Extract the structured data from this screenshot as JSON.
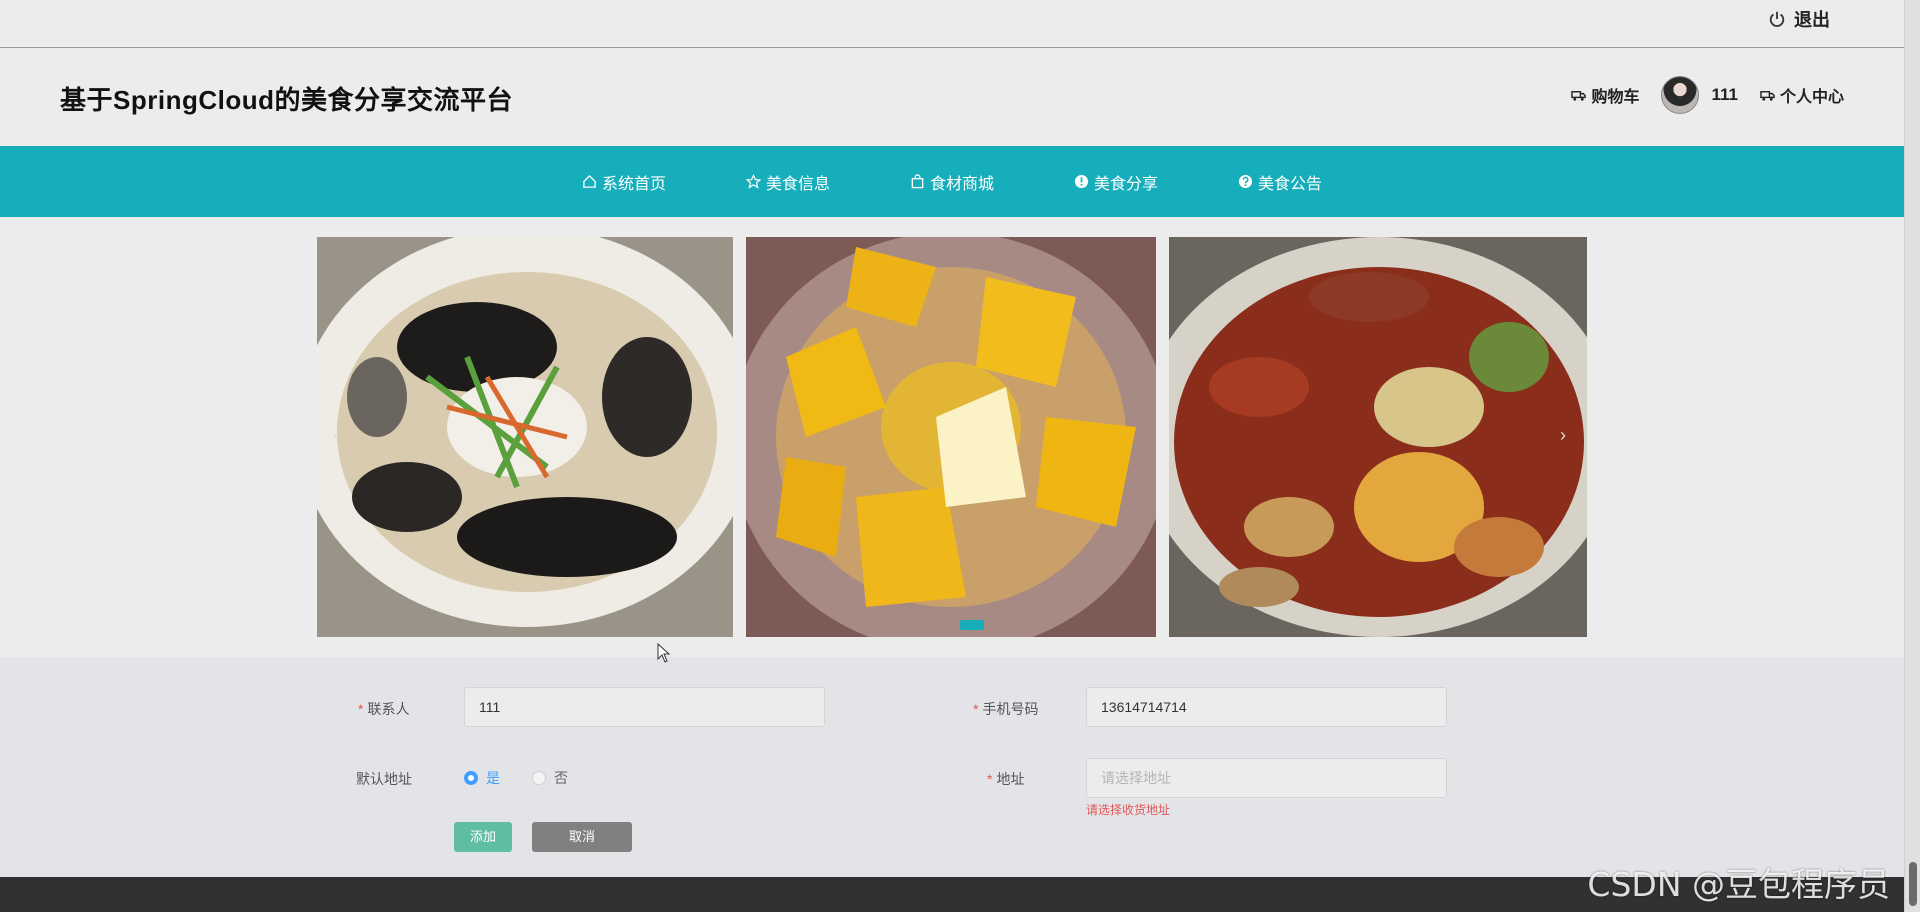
{
  "topbar": {
    "logout_label": "退出"
  },
  "header": {
    "site_title": "基于SpringCloud的美食分享交流平台",
    "cart_label": "购物车",
    "username": "111",
    "user_center_label": "个人中心"
  },
  "nav": {
    "items": [
      {
        "label": "系统首页",
        "icon": "home-icon"
      },
      {
        "label": "美食信息",
        "icon": "star-icon"
      },
      {
        "label": "食材商城",
        "icon": "shopping-bag-icon"
      },
      {
        "label": "美食分享",
        "icon": "info-icon"
      },
      {
        "label": "美食公告",
        "icon": "question-icon"
      }
    ],
    "color": "#17aebb"
  },
  "carousel": {
    "prev_arrow": "‹",
    "next_arrow": "›",
    "slides": [
      "food-photo-fish-fungus",
      "food-photo-sea-urchin",
      "food-photo-clams-scallops"
    ],
    "active_dot": 1
  },
  "form": {
    "contact": {
      "label": "联系人",
      "value": "111"
    },
    "phone": {
      "label": "手机号码",
      "value": "13614714714"
    },
    "default_address": {
      "label": "默认地址",
      "options": [
        "是",
        "否"
      ],
      "selected": "是"
    },
    "address": {
      "label": "地址",
      "placeholder": "请选择地址",
      "error": "请选择收货地址"
    },
    "add_button": "添加",
    "cancel_button": "取消",
    "required_mark": "*"
  },
  "watermark": "CSDN @豆包程序员"
}
